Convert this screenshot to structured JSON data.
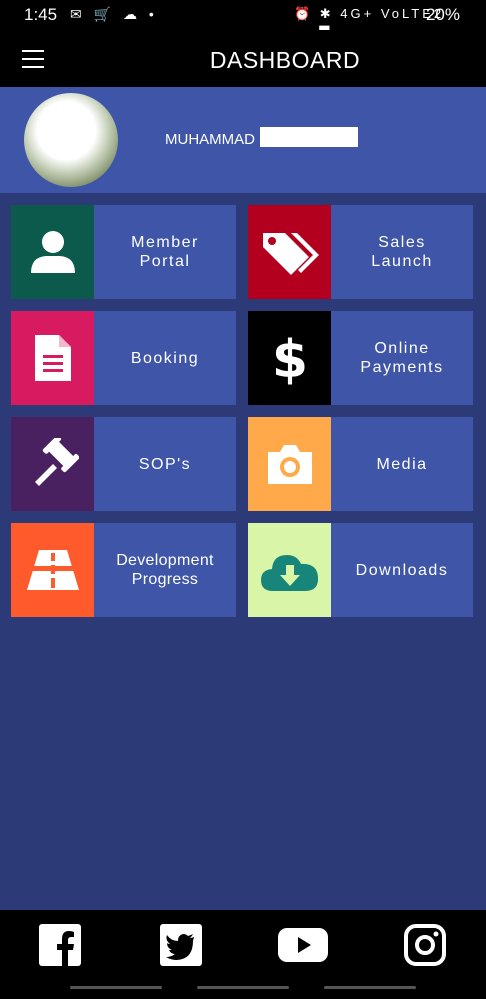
{
  "status_bar": {
    "time": "1:45",
    "left_icons": "✉ 🛒 ☁ •",
    "right_icons": "⏰ ✱ 4G+ VoLTE2 ▂▄▆",
    "battery": "20%"
  },
  "header": {
    "title": "DASHBOARD"
  },
  "profile": {
    "name": "MUHAMMAD"
  },
  "tiles": [
    {
      "label": "Member\nPortal",
      "icon": "user-icon",
      "color": "#0b5a4c"
    },
    {
      "label": "Sales\nLaunch",
      "icon": "tags-icon",
      "color": "#b3001f"
    },
    {
      "label": "Booking",
      "icon": "document-icon",
      "color": "#d81b60"
    },
    {
      "label": "Online\nPayments",
      "icon": "dollar-icon",
      "color": "#000000"
    },
    {
      "label": "SOP's",
      "icon": "gavel-icon",
      "color": "#4a2160"
    },
    {
      "label": "Media",
      "icon": "camera-icon",
      "color": "#ffa94a"
    },
    {
      "label": "Development\nProgress",
      "icon": "road-icon",
      "color": "#ff5a2c"
    },
    {
      "label": "Downloads",
      "icon": "cloud-download-icon",
      "color": "#d9f6a8"
    }
  ],
  "social": [
    "facebook-icon",
    "twitter-icon",
    "youtube-icon",
    "instagram-icon"
  ],
  "colors": {
    "background": "#2c3a78",
    "tile": "#3e55a8",
    "bars": "#000000"
  }
}
